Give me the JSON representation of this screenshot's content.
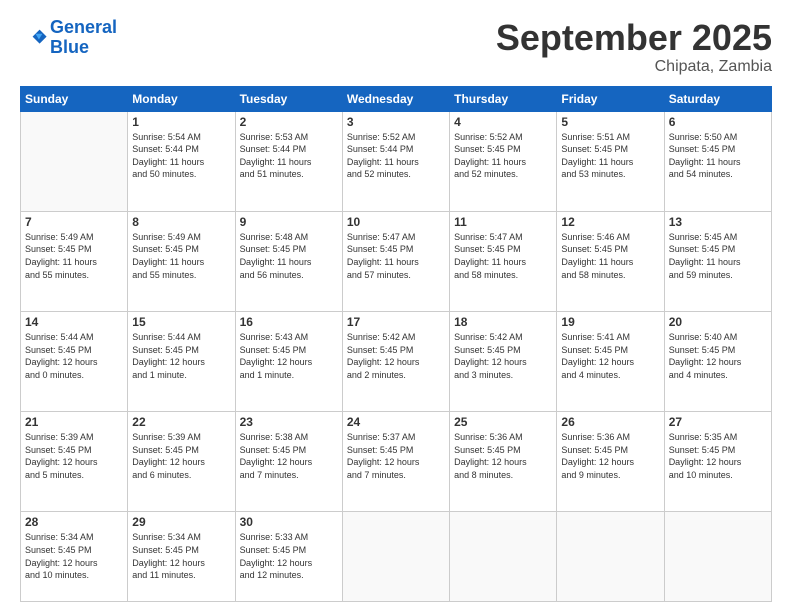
{
  "logo": {
    "line1": "General",
    "line2": "Blue"
  },
  "title": "September 2025",
  "subtitle": "Chipata, Zambia",
  "header_days": [
    "Sunday",
    "Monday",
    "Tuesday",
    "Wednesday",
    "Thursday",
    "Friday",
    "Saturday"
  ],
  "weeks": [
    [
      {
        "day": "",
        "info": ""
      },
      {
        "day": "1",
        "info": "Sunrise: 5:54 AM\nSunset: 5:44 PM\nDaylight: 11 hours\nand 50 minutes."
      },
      {
        "day": "2",
        "info": "Sunrise: 5:53 AM\nSunset: 5:44 PM\nDaylight: 11 hours\nand 51 minutes."
      },
      {
        "day": "3",
        "info": "Sunrise: 5:52 AM\nSunset: 5:44 PM\nDaylight: 11 hours\nand 52 minutes."
      },
      {
        "day": "4",
        "info": "Sunrise: 5:52 AM\nSunset: 5:45 PM\nDaylight: 11 hours\nand 52 minutes."
      },
      {
        "day": "5",
        "info": "Sunrise: 5:51 AM\nSunset: 5:45 PM\nDaylight: 11 hours\nand 53 minutes."
      },
      {
        "day": "6",
        "info": "Sunrise: 5:50 AM\nSunset: 5:45 PM\nDaylight: 11 hours\nand 54 minutes."
      }
    ],
    [
      {
        "day": "7",
        "info": "Sunrise: 5:49 AM\nSunset: 5:45 PM\nDaylight: 11 hours\nand 55 minutes."
      },
      {
        "day": "8",
        "info": "Sunrise: 5:49 AM\nSunset: 5:45 PM\nDaylight: 11 hours\nand 55 minutes."
      },
      {
        "day": "9",
        "info": "Sunrise: 5:48 AM\nSunset: 5:45 PM\nDaylight: 11 hours\nand 56 minutes."
      },
      {
        "day": "10",
        "info": "Sunrise: 5:47 AM\nSunset: 5:45 PM\nDaylight: 11 hours\nand 57 minutes."
      },
      {
        "day": "11",
        "info": "Sunrise: 5:47 AM\nSunset: 5:45 PM\nDaylight: 11 hours\nand 58 minutes."
      },
      {
        "day": "12",
        "info": "Sunrise: 5:46 AM\nSunset: 5:45 PM\nDaylight: 11 hours\nand 58 minutes."
      },
      {
        "day": "13",
        "info": "Sunrise: 5:45 AM\nSunset: 5:45 PM\nDaylight: 11 hours\nand 59 minutes."
      }
    ],
    [
      {
        "day": "14",
        "info": "Sunrise: 5:44 AM\nSunset: 5:45 PM\nDaylight: 12 hours\nand 0 minutes."
      },
      {
        "day": "15",
        "info": "Sunrise: 5:44 AM\nSunset: 5:45 PM\nDaylight: 12 hours\nand 1 minute."
      },
      {
        "day": "16",
        "info": "Sunrise: 5:43 AM\nSunset: 5:45 PM\nDaylight: 12 hours\nand 1 minute."
      },
      {
        "day": "17",
        "info": "Sunrise: 5:42 AM\nSunset: 5:45 PM\nDaylight: 12 hours\nand 2 minutes."
      },
      {
        "day": "18",
        "info": "Sunrise: 5:42 AM\nSunset: 5:45 PM\nDaylight: 12 hours\nand 3 minutes."
      },
      {
        "day": "19",
        "info": "Sunrise: 5:41 AM\nSunset: 5:45 PM\nDaylight: 12 hours\nand 4 minutes."
      },
      {
        "day": "20",
        "info": "Sunrise: 5:40 AM\nSunset: 5:45 PM\nDaylight: 12 hours\nand 4 minutes."
      }
    ],
    [
      {
        "day": "21",
        "info": "Sunrise: 5:39 AM\nSunset: 5:45 PM\nDaylight: 12 hours\nand 5 minutes."
      },
      {
        "day": "22",
        "info": "Sunrise: 5:39 AM\nSunset: 5:45 PM\nDaylight: 12 hours\nand 6 minutes."
      },
      {
        "day": "23",
        "info": "Sunrise: 5:38 AM\nSunset: 5:45 PM\nDaylight: 12 hours\nand 7 minutes."
      },
      {
        "day": "24",
        "info": "Sunrise: 5:37 AM\nSunset: 5:45 PM\nDaylight: 12 hours\nand 7 minutes."
      },
      {
        "day": "25",
        "info": "Sunrise: 5:36 AM\nSunset: 5:45 PM\nDaylight: 12 hours\nand 8 minutes."
      },
      {
        "day": "26",
        "info": "Sunrise: 5:36 AM\nSunset: 5:45 PM\nDaylight: 12 hours\nand 9 minutes."
      },
      {
        "day": "27",
        "info": "Sunrise: 5:35 AM\nSunset: 5:45 PM\nDaylight: 12 hours\nand 10 minutes."
      }
    ],
    [
      {
        "day": "28",
        "info": "Sunrise: 5:34 AM\nSunset: 5:45 PM\nDaylight: 12 hours\nand 10 minutes."
      },
      {
        "day": "29",
        "info": "Sunrise: 5:34 AM\nSunset: 5:45 PM\nDaylight: 12 hours\nand 11 minutes."
      },
      {
        "day": "30",
        "info": "Sunrise: 5:33 AM\nSunset: 5:45 PM\nDaylight: 12 hours\nand 12 minutes."
      },
      {
        "day": "",
        "info": ""
      },
      {
        "day": "",
        "info": ""
      },
      {
        "day": "",
        "info": ""
      },
      {
        "day": "",
        "info": ""
      }
    ]
  ]
}
